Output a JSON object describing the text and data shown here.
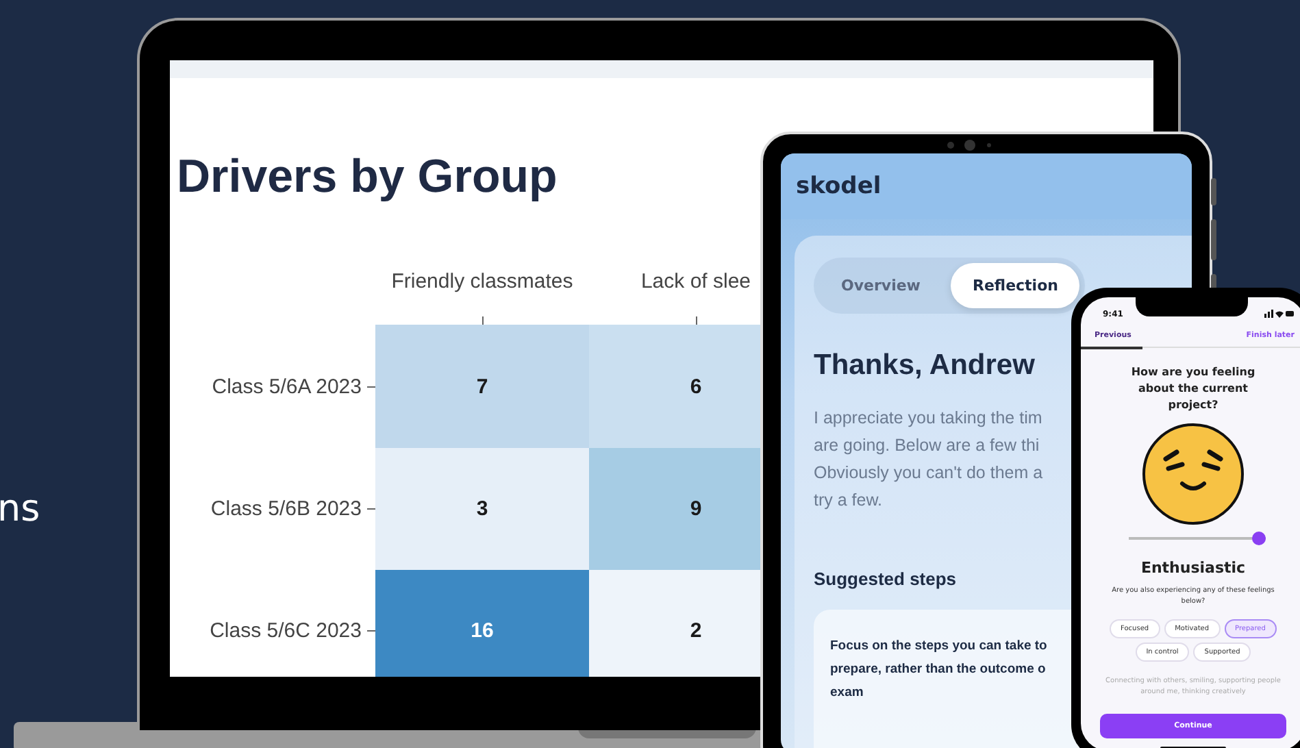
{
  "side_text": "ns",
  "laptop": {
    "title": "Drivers by Group",
    "heatmap": {
      "columns": [
        "Friendly classmates",
        "Lack of slee"
      ],
      "rows": [
        {
          "label": "Class 5/6A 2023",
          "cells": [
            {
              "value": "7",
              "color": "#c0d8ec"
            },
            {
              "value": "6",
              "color": "#cadff0"
            }
          ]
        },
        {
          "label": "Class 5/6B 2023",
          "cells": [
            {
              "value": "3",
              "color": "#e6eff8"
            },
            {
              "value": "9",
              "color": "#a6cce4"
            }
          ]
        },
        {
          "label": "Class 5/6C 2023",
          "cells": [
            {
              "value": "16",
              "color": "#3d89c3"
            },
            {
              "value": "2",
              "color": "#eef4fa"
            }
          ]
        }
      ]
    }
  },
  "tablet": {
    "logo": "skodel",
    "tabs": [
      {
        "label": "Overview",
        "selected": false
      },
      {
        "label": "Reflection",
        "selected": true
      }
    ],
    "heading": "Thanks, Andrew",
    "paragraph_lines": [
      "I appreciate you taking the tim",
      "are going. Below are a few thi",
      "Obviously you can't do them a",
      "try a few."
    ],
    "section_title": "Suggested steps",
    "step_lines": [
      "Focus on the steps you can take to",
      "prepare, rather than the outcome o",
      "exam"
    ]
  },
  "phone": {
    "time": "9:41",
    "previous": "Previous",
    "finish_later": "Finish later",
    "question": "How are you feeling about the current project?",
    "slider": {
      "level": 1.0
    },
    "mood": "Enthusiastic",
    "prompt": "Are you also experiencing any of these feelings below?",
    "chips": [
      {
        "label": "Focused",
        "selected": false
      },
      {
        "label": "Motivated",
        "selected": false
      },
      {
        "label": "Prepared",
        "selected": true
      },
      {
        "label": "In control",
        "selected": false
      },
      {
        "label": "Supported",
        "selected": false
      }
    ],
    "caption": "Connecting with others, smiling, supporting people around me, thinking creatively",
    "button": "Continue"
  }
}
